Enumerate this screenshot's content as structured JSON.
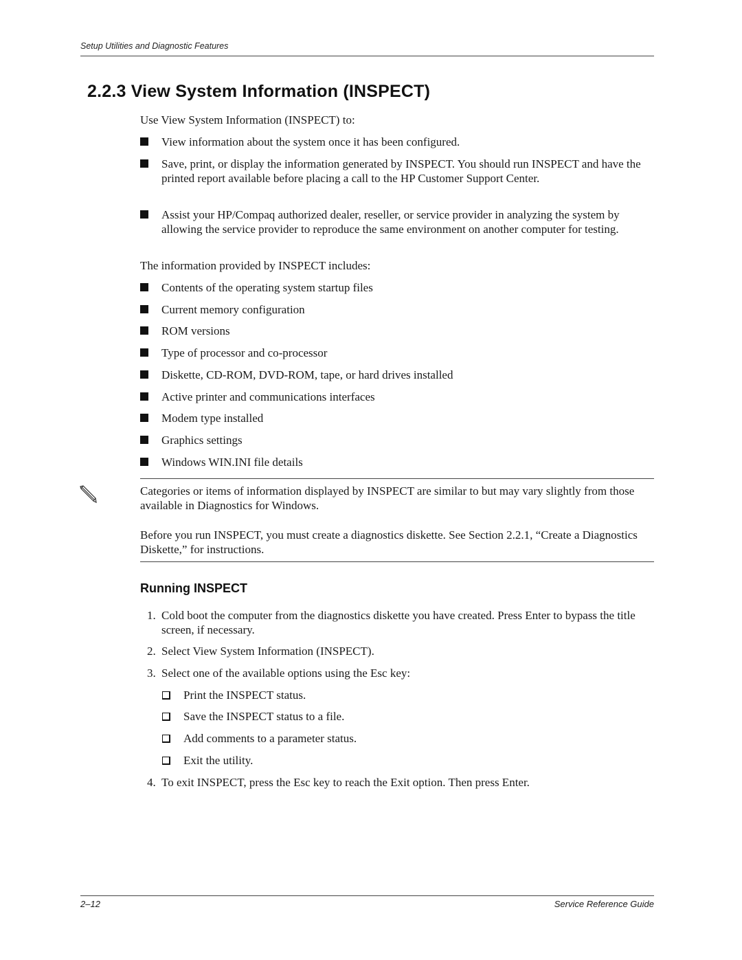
{
  "header": {
    "running_title": "Setup Utilities and Diagnostic Features"
  },
  "section": {
    "title": "2.2.3 View System Information (INSPECT)",
    "intro": "Use View System Information (INSPECT) to:",
    "uses": [
      "View information about the system once it has been configured.",
      "Save, print, or display the information generated by INSPECT. You should run INSPECT and have the printed report available before placing a call to the HP Customer Support Center.",
      "Assist your HP/Compaq authorized dealer, reseller, or service provider in analyzing the system by allowing the service provider to reproduce the same environment on another computer for testing."
    ],
    "includes_intro": "The information provided by INSPECT includes:",
    "includes": [
      "Contents of the operating system startup files",
      "Current memory configuration",
      "ROM versions",
      "Type of processor and co-processor",
      "Diskette, CD-ROM, DVD-ROM, tape, or hard drives installed",
      "Active printer and communications interfaces",
      "Modem type installed",
      "Graphics settings",
      "Windows WIN.INI file details"
    ]
  },
  "note": {
    "icon": "pencil-note-icon",
    "paragraph1": "Categories or items of information displayed by INSPECT are similar to but may vary slightly from those available in Diagnostics for Windows.",
    "paragraph2": "Before you run INSPECT, you must create a diagnostics diskette. See Section 2.2.1, “Create a Diagnostics Diskette,” for instructions."
  },
  "running": {
    "title": "Running INSPECT",
    "steps": [
      {
        "num": "1.",
        "text": "Cold boot the computer from the diagnostics diskette you have created. Press Enter to bypass the title screen, if necessary."
      },
      {
        "num": "2.",
        "text": "Select View System Information (INSPECT)."
      },
      {
        "num": "3.",
        "text": "Select one of the available options using the Esc key:"
      },
      {
        "num": "4.",
        "text": "To exit INSPECT, press the Esc key to reach the Exit option. Then press Enter."
      }
    ],
    "options": [
      "Print the INSPECT status.",
      "Save the INSPECT status to a file.",
      "Add comments to a parameter status.",
      "Exit the utility."
    ]
  },
  "footer": {
    "page_number": "2–12",
    "guide_title": "Service Reference Guide"
  }
}
